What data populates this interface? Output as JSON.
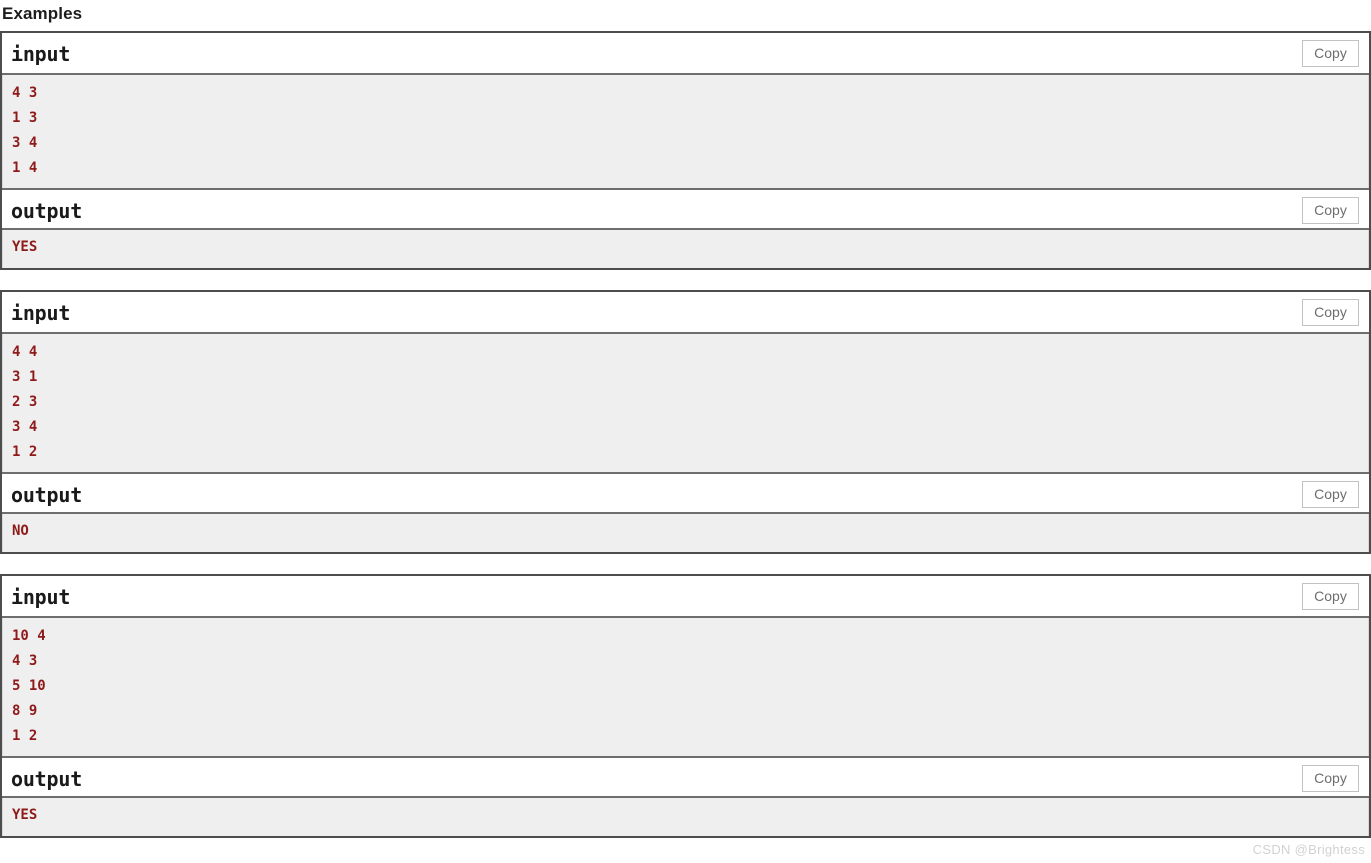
{
  "section": {
    "heading": "Examples"
  },
  "labels": {
    "input_label": "input",
    "output_label": "output",
    "copy_label": "Copy"
  },
  "colors": {
    "code_text": "#8f1a1a",
    "code_background": "#efefef",
    "block_border": "#4d4d4d",
    "divider": "#6e6e6e",
    "copy_border": "#c2c2c2",
    "copy_text": "#6d6d6d",
    "heading_text": "#1d1d1d",
    "watermark_text": "#d2d2d2"
  },
  "examples": [
    {
      "input_label": "input",
      "output_label": "output",
      "copy_label": "Copy",
      "input": "4 3\n1 3\n3 4\n1 4",
      "output": "YES"
    },
    {
      "input_label": "input",
      "output_label": "output",
      "copy_label": "Copy",
      "input": "4 4\n3 1\n2 3\n3 4\n1 2",
      "output": "NO"
    },
    {
      "input_label": "input",
      "output_label": "output",
      "copy_label": "Copy",
      "input": "10 4\n4 3\n5 10\n8 9\n1 2",
      "output": "YES"
    }
  ],
  "watermark": {
    "text": "CSDN @Brightess"
  }
}
